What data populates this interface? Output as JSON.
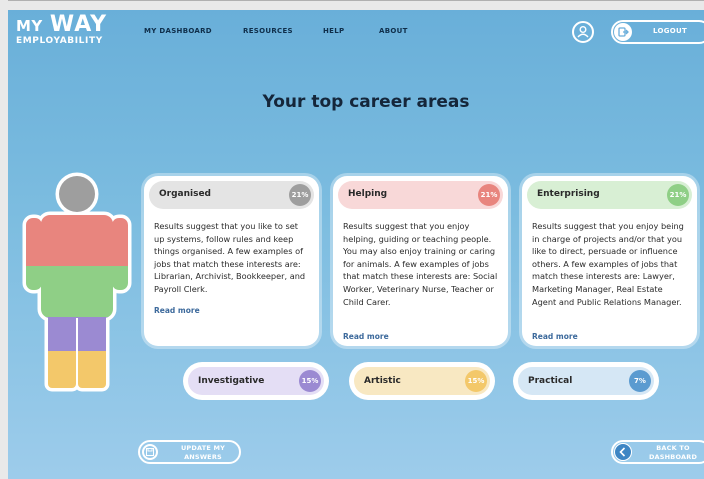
{
  "logo": {
    "line1_a": "MY",
    "line1_b": "WAY",
    "line2": "EMPLOYABILITY"
  },
  "nav": [
    {
      "label": "MY DASHBOARD"
    },
    {
      "label": "RESOURCES"
    },
    {
      "label": "HELP"
    },
    {
      "label": "ABOUT"
    }
  ],
  "header": {
    "user_icon": "user-icon",
    "logout_label": "LOGOUT",
    "logout_icon": "logout-icon"
  },
  "page": {
    "title": "Your top career areas"
  },
  "figure": {
    "colors": {
      "head": "#9e9e9e",
      "torso": "#e8857e",
      "arms_lower": "#8fcf86",
      "hips": "#8fcf86",
      "legs_upper": "#9b8ad2",
      "legs_lower": "#f3c86a"
    }
  },
  "top_areas": [
    {
      "name": "Organised",
      "percent": "21%",
      "pill_color": "#e4e4e4",
      "badge_color": "#9e9e9e",
      "description": "Results suggest that you like to set up systems, follow rules and keep things organised. A few examples of jobs that match these interests are: Librarian, Archivist, Bookkeeper, and Payroll Clerk.",
      "read_more": "Read more"
    },
    {
      "name": "Helping",
      "percent": "21%",
      "pill_color": "#f8d8d8",
      "badge_color": "#e8857e",
      "description": "Results suggest that you enjoy helping, guiding or teaching people. You may also enjoy training or caring for animals. A few examples of jobs that match these interests are: Social Worker, Veterinary Nurse, Teacher or Child Carer.",
      "read_more": "Read more"
    },
    {
      "name": "Enterprising",
      "percent": "21%",
      "pill_color": "#d8efd4",
      "badge_color": "#8fcf86",
      "description": "Results suggest that you enjoy being in charge of projects and/or that you like to direct, persuade or influence others. A few examples of jobs that match these interests are: Lawyer, Marketing Manager, Real Estate Agent and Public Relations Manager.",
      "read_more": "Read more"
    }
  ],
  "other_areas": [
    {
      "name": "Investigative",
      "percent": "15%",
      "pill_color": "#e4def5",
      "badge_color": "#9b8ad2"
    },
    {
      "name": "Artistic",
      "percent": "15%",
      "pill_color": "#f8e8c2",
      "badge_color": "#f3c86a"
    },
    {
      "name": "Practical",
      "percent": "7%",
      "pill_color": "#d5e7f5",
      "badge_color": "#5b9bd0"
    }
  ],
  "footer": {
    "update_label_1": "UPDATE MY",
    "update_label_2": "ANSWERS",
    "update_icon": "save-icon",
    "back_label_1": "BACK TO",
    "back_label_2": "DASHBOARD",
    "back_icon": "chevron-left-icon"
  }
}
